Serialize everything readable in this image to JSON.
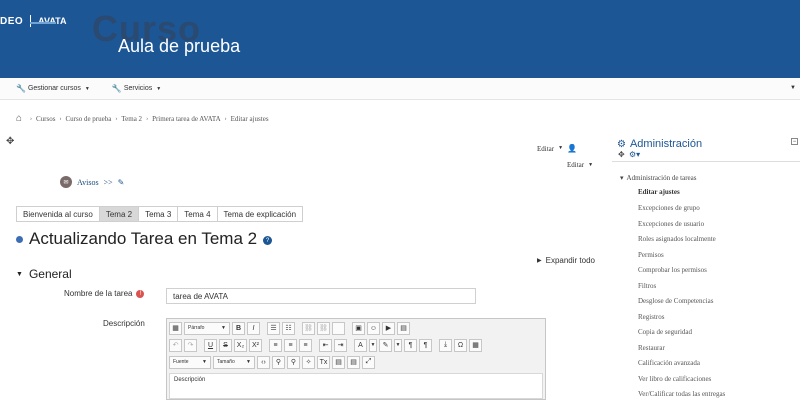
{
  "header": {
    "logo_left": "DEO",
    "logo_right": "AVATA",
    "bg_text": "Curso",
    "title": "Aula de prueba"
  },
  "navbar": {
    "items": [
      {
        "label": "Gestionar cursos"
      },
      {
        "label": "Servicios"
      }
    ]
  },
  "breadcrumb": {
    "items": [
      "Cursos",
      "Curso de prueba",
      "Tema 2",
      "Primera tarea de AVATA",
      "Editar ajustes"
    ]
  },
  "edit_links": {
    "editar_top": "Editar",
    "editar_second": "Editar"
  },
  "avisos": {
    "label": "Avisos"
  },
  "tabs": [
    {
      "label": "Bienvenida al curso"
    },
    {
      "label": "Tema 2"
    },
    {
      "label": "Tema 3"
    },
    {
      "label": "Tema 4"
    },
    {
      "label": "Tema de explicación"
    }
  ],
  "active_tab": "Tema 2",
  "page_title": "Actualizando Tarea en Tema 2",
  "expand_all": "Expandir todo",
  "section": {
    "title": "General"
  },
  "form": {
    "name_label": "Nombre de la tarea",
    "name_value": "tarea de AVATA",
    "description_label": "Descripción"
  },
  "editor": {
    "format_select": "Párrafo",
    "font_select": "Fuente",
    "size_select": "Tamaño",
    "body_text": "Descripción"
  },
  "admin": {
    "title": "Administración",
    "root": "Administración de tareas",
    "items": [
      {
        "label": "Editar ajustes",
        "current": true
      },
      {
        "label": "Excepciones de grupo"
      },
      {
        "label": "Excepciones de usuario"
      },
      {
        "label": "Roles asignados localmente"
      },
      {
        "label": "Permisos"
      },
      {
        "label": "Comprobar los permisos"
      },
      {
        "label": "Filtros"
      },
      {
        "label": "Desglose de Competencias"
      },
      {
        "label": "Registros"
      },
      {
        "label": "Copia de seguridad"
      },
      {
        "label": "Restaurar"
      },
      {
        "label": "Calificación avanzada"
      },
      {
        "label": "Ver libro de calificaciones"
      },
      {
        "label": "Ver/Calificar todas las entregas"
      }
    ]
  },
  "colors": {
    "header_bg": "#1c5694",
    "accent": "#1c5694",
    "active_tab_bg": "#d8d8d8",
    "required": "#d9534f"
  }
}
